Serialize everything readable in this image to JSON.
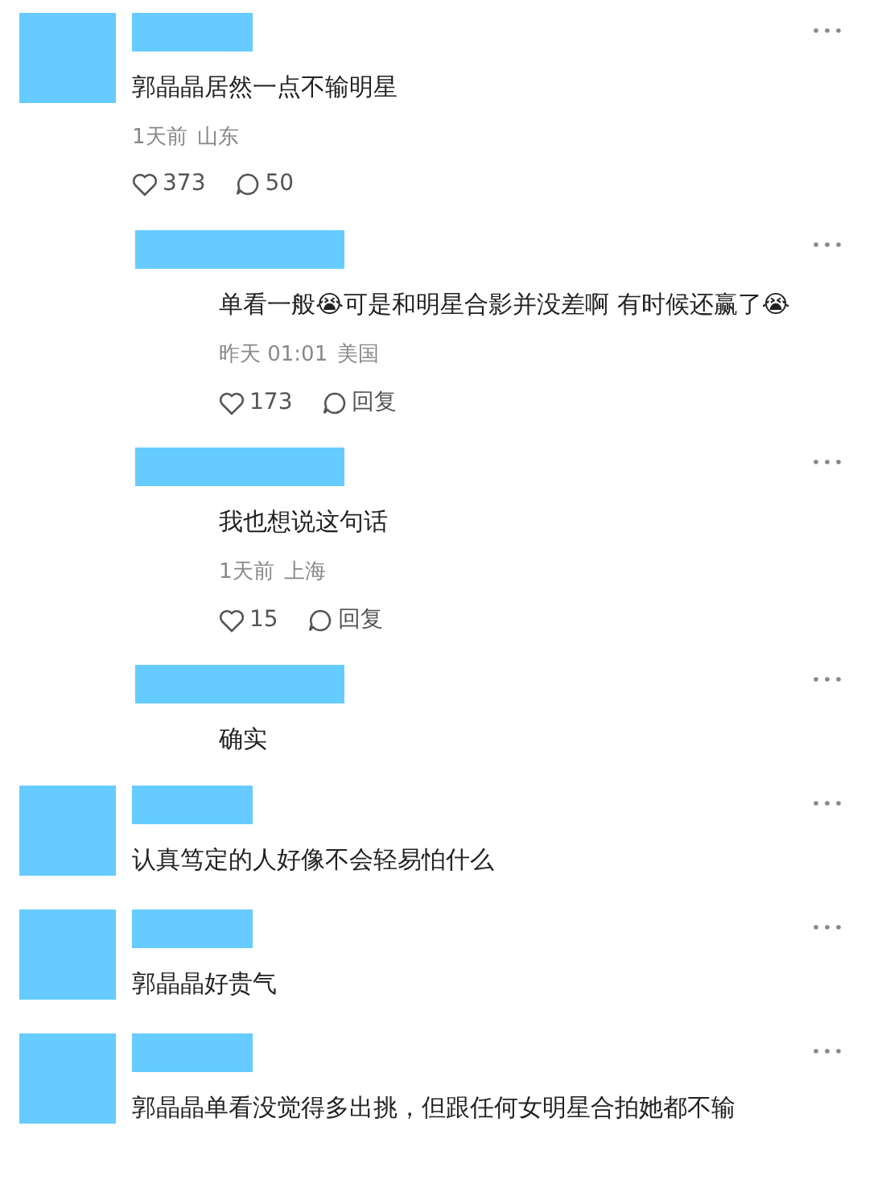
{
  "comments": [
    {
      "text": "郭晶晶居然一点不输明星",
      "time": "1天前",
      "location": "山东",
      "likes": "373",
      "reply_label": "50",
      "replies": [
        {
          "text": "单看一般😭可是和明星合影并没差啊 有时候还赢了😭",
          "time": "昨天 01:01",
          "location": "美国",
          "likes": "173",
          "reply_label": "回复"
        },
        {
          "text": "我也想说这句话",
          "time": "1天前",
          "location": "上海",
          "likes": "15",
          "reply_label": "回复"
        },
        {
          "text": "确实"
        }
      ]
    },
    {
      "text": "认真笃定的人好像不会轻易怕什么"
    },
    {
      "text": "郭晶晶好贵气"
    },
    {
      "text": "郭晶晶单看没觉得多出挑，但跟任何女明星合拍她都不输"
    }
  ]
}
